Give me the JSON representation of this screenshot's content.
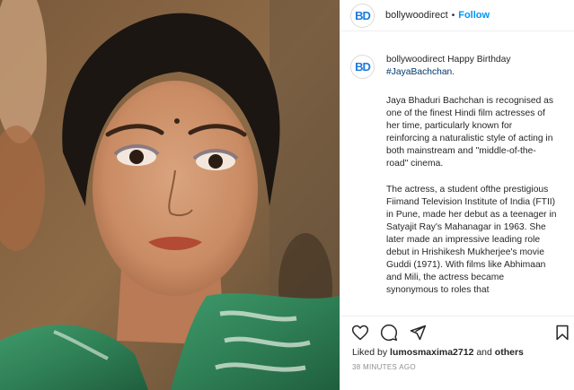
{
  "post": {
    "username": "bollywoodirect",
    "avatar_text": "BD",
    "header_separator": "•",
    "follow_label": "Follow"
  },
  "caption": {
    "username": "bollywoodirect",
    "greeting": "Happy Birthday",
    "hashtag": "#JayaBachchan",
    "period": ".",
    "paragraph1": "Jaya Bhaduri Bachchan is recognised as one of the finest Hindi film actresses of her time, particularly known for reinforcing a naturalistic style of acting in both mainstream and \"middle-of-the-road\" cinema.",
    "paragraph2": "The actress, a student ofthe prestigious Fiimand Television Institute of India (FTII) in Pune, made her debut as a teenager in Satyajit Ray's Mahanagar in 1963. She later made an impressive leading role debut in Hrishikesh Mukherjee's movie Guddi (1971). With films like Abhimaan and Mili, the actress became synonymous to roles that"
  },
  "likes": {
    "prefix": "Liked by",
    "user": "lumosmaxima2712",
    "joiner": "and",
    "others": "others"
  },
  "timestamp": "38 MINUTES AGO",
  "icons": {
    "like": "heart-icon",
    "comment": "comment-icon",
    "share": "share-icon",
    "save": "bookmark-icon"
  },
  "colors": {
    "accent": "#0095f6",
    "hashtag": "#00376b",
    "brand": "#1d7be0",
    "muted": "#8e8e8e"
  }
}
